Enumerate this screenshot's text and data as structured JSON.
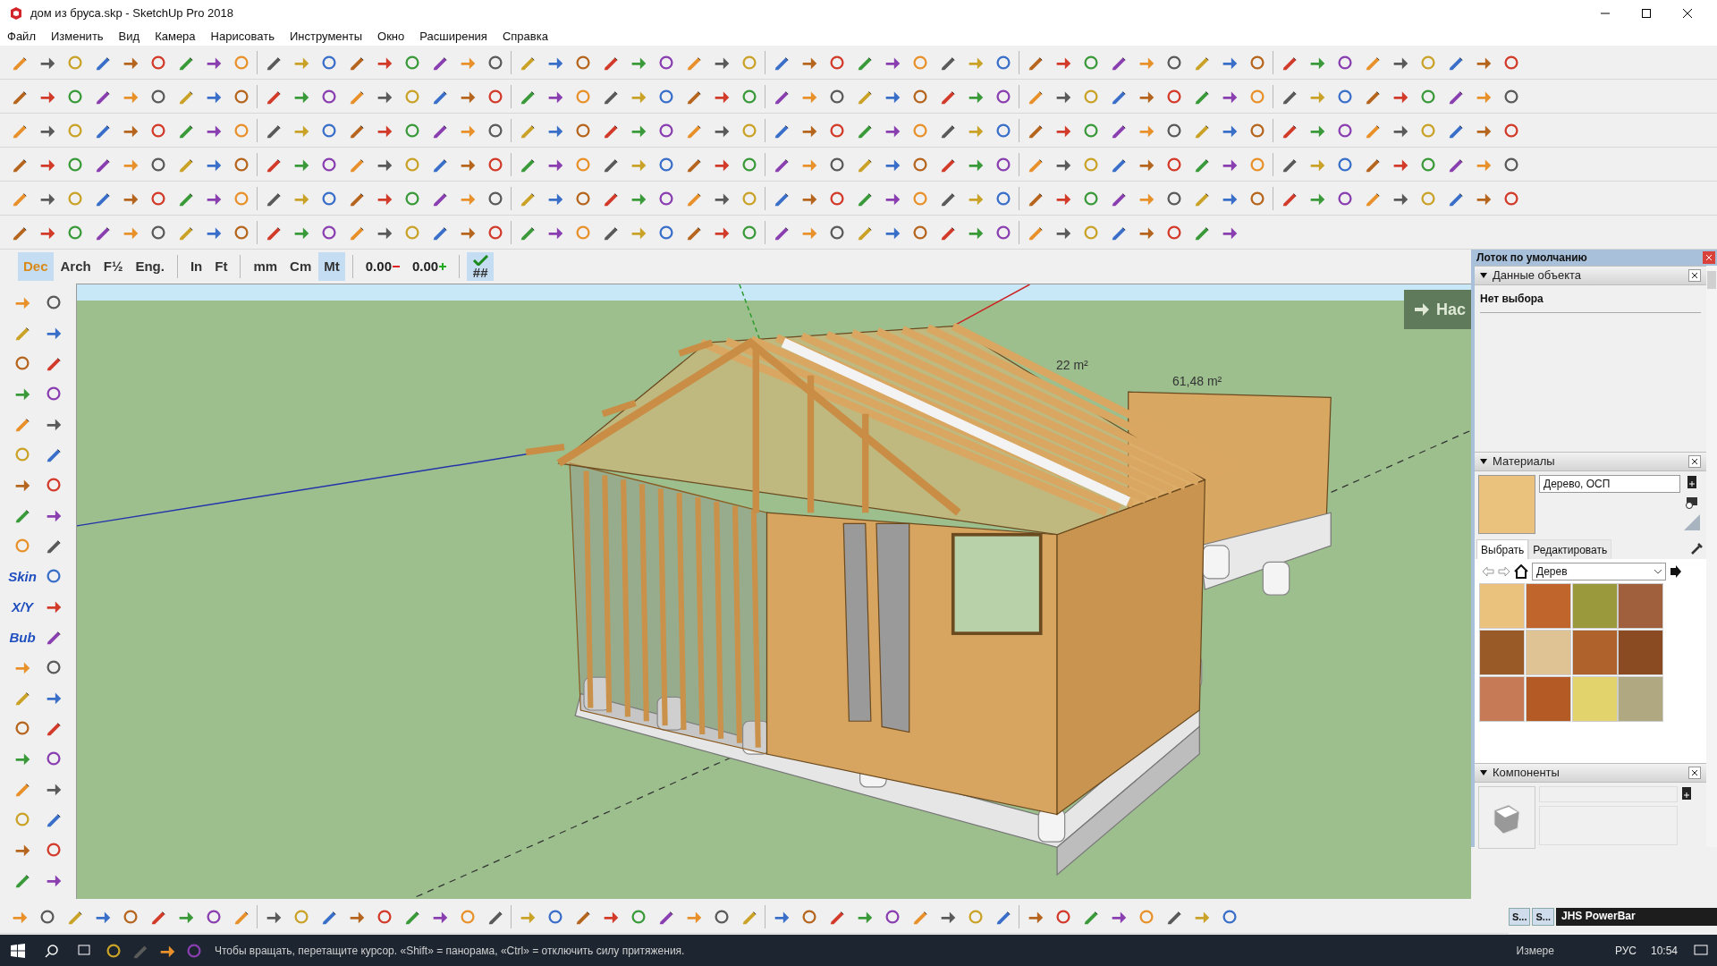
{
  "window": {
    "title": "дом из бруса.skp - SketchUp Pro 2018"
  },
  "menu": [
    "Файл",
    "Изменить",
    "Вид",
    "Камера",
    "Нарисовать",
    "Инструменты",
    "Окно",
    "Расширения",
    "Справка"
  ],
  "units_toolbar": [
    {
      "kind": "unit",
      "label": "Dec",
      "selected": true
    },
    {
      "kind": "unit",
      "label": "Arch",
      "selected": false
    },
    {
      "kind": "unit",
      "label": "F½",
      "selected": false
    },
    {
      "kind": "unit",
      "label": "Eng.",
      "selected": false
    },
    {
      "kind": "unit",
      "label": "In",
      "selected": false
    },
    {
      "kind": "unit",
      "label": "Ft",
      "selected": false
    },
    {
      "kind": "unit",
      "label": "mm",
      "selected": false
    },
    {
      "kind": "unit",
      "label": "Cm",
      "selected": false
    },
    {
      "kind": "unit",
      "label": "Mt",
      "selected": true
    },
    {
      "kind": "minus",
      "label": "0.00",
      "selected": false
    },
    {
      "kind": "plus",
      "label": "0.00",
      "selected": false
    },
    {
      "kind": "check",
      "label": "##",
      "selected": true
    }
  ],
  "left_toolbar_labels": [
    "Skin",
    "X/Y",
    "Bub"
  ],
  "viewport": {
    "labels": [
      "22 m²",
      "61,48 m²"
    ],
    "overlay_button": "Нас"
  },
  "tray": {
    "title": "Лоток по умолчанию",
    "entity_info": {
      "title": "Данные объекта",
      "expanded": true,
      "text": "Нет выбора"
    },
    "materials": {
      "title": "Материалы",
      "expanded": true,
      "name": "Дерево, ОСП",
      "tabs": [
        {
          "label": "Выбрать",
          "selected": true
        },
        {
          "label": "Редактировать",
          "selected": false
        }
      ],
      "collection": "Дерев",
      "swatches": [
        {
          "color": "#eac27e"
        },
        {
          "color": "#c0662c"
        },
        {
          "color": "#9a9a3c"
        },
        {
          "color": "#a0603e"
        },
        {
          "color": "#9a5a28"
        },
        {
          "color": "#e0c394"
        },
        {
          "color": "#b0622c"
        },
        {
          "color": "#8a4a22"
        },
        {
          "color": "#c77a56"
        },
        {
          "color": "#b45a24"
        },
        {
          "color": "#e3d36c"
        },
        {
          "color": "#b0a880"
        }
      ]
    },
    "components": {
      "title": "Компоненты",
      "expanded": true
    }
  },
  "mini_panels": [
    "S...",
    "S..."
  ],
  "powerbar": "JHS PowerBar",
  "status_bar": {
    "text": "Чтобы вращать, перетащите курсор. «Shift» = панорама, «Ctrl» = отключить силу притяжения.",
    "measurements_label": "Измере"
  },
  "taskbar": {
    "language": "РУС",
    "time": "10:54"
  }
}
